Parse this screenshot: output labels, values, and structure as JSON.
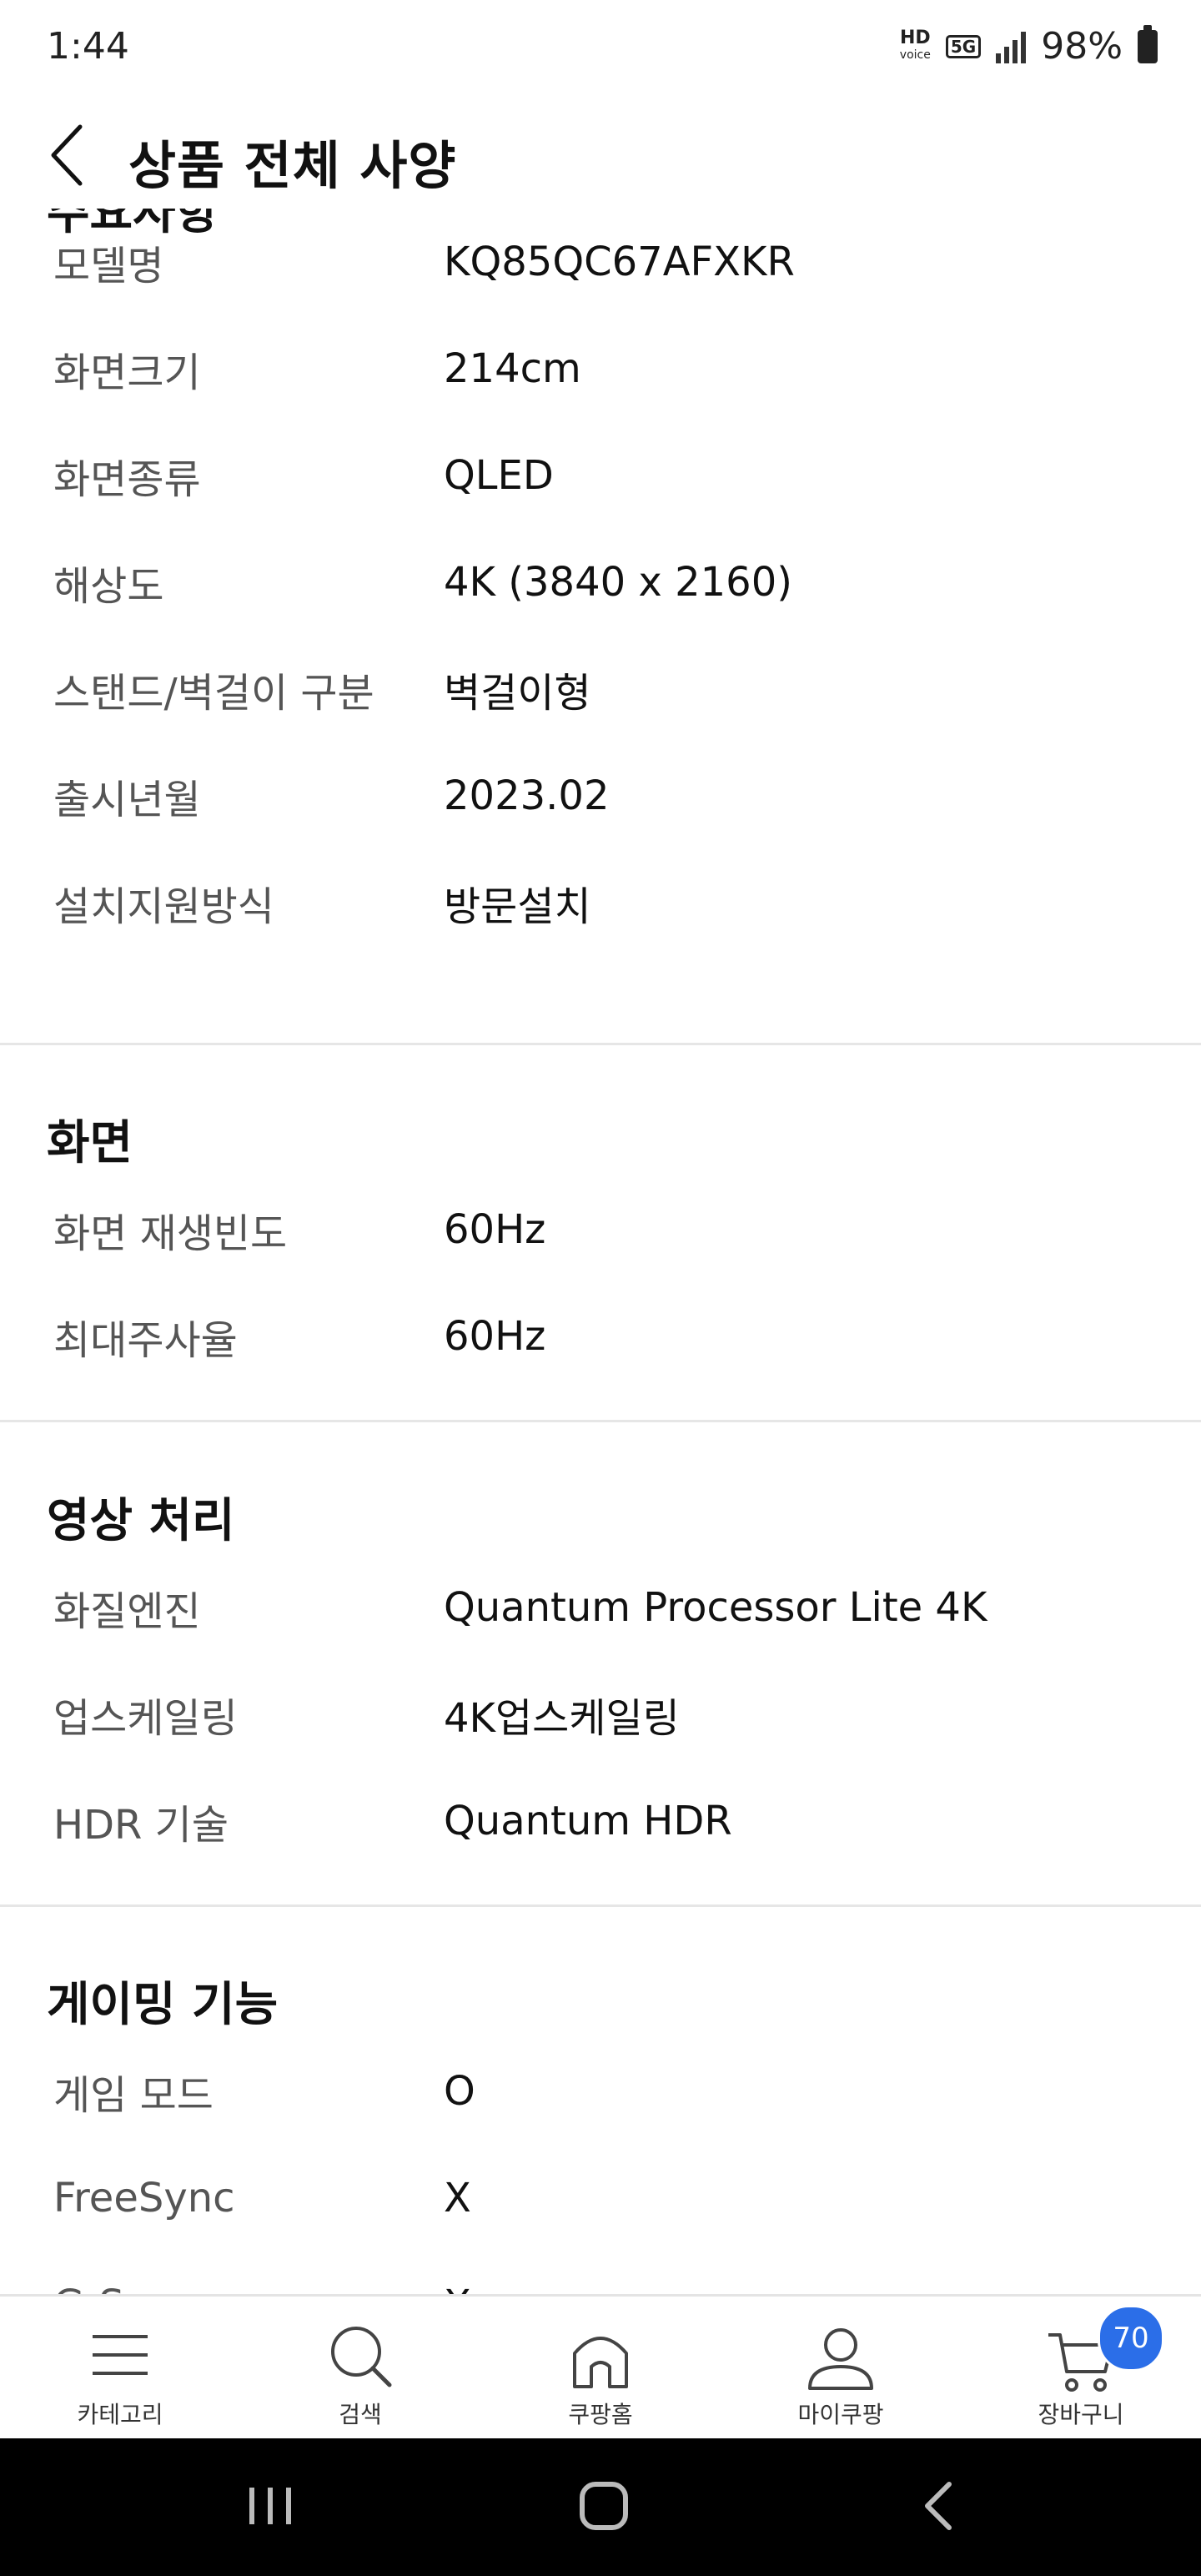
{
  "status_bar": {
    "time": "1:44",
    "hd_label": "HD",
    "voice_label": "voice",
    "network_label": "5G",
    "battery": "98%"
  },
  "header": {
    "title": "상품 전체 사양",
    "back_icon": "chevron-left-icon"
  },
  "partial_section_title": "주요사항",
  "sections": [
    {
      "rows": [
        {
          "label": "모델명",
          "value": "KQ85QC67AFXKR"
        },
        {
          "label": "화면크기",
          "value": "214cm"
        },
        {
          "label": "화면종류",
          "value": "QLED"
        },
        {
          "label": "해상도",
          "value": "4K (3840 x 2160)"
        },
        {
          "label": "스탠드/벽걸이 구분",
          "value": "벽걸이형"
        },
        {
          "label": "출시년월",
          "value": "2023.02"
        },
        {
          "label": "설치지원방식",
          "value": "방문설치"
        }
      ]
    },
    {
      "title": "화면",
      "rows": [
        {
          "label": "화면 재생빈도",
          "value": "60Hz"
        },
        {
          "label": "최대주사율",
          "value": "60Hz"
        }
      ]
    },
    {
      "title": "영상 처리",
      "rows": [
        {
          "label": "화질엔진",
          "value": "Quantum Processor Lite 4K"
        },
        {
          "label": "업스케일링",
          "value": "4K업스케일링"
        },
        {
          "label": "HDR 기술",
          "value": "Quantum HDR"
        }
      ]
    },
    {
      "title": "게이밍 기능",
      "rows": [
        {
          "label": "게임 모드",
          "value": "O"
        },
        {
          "label": "FreeSync",
          "value": "X"
        },
        {
          "label": "G-S",
          "value": "X"
        }
      ]
    }
  ],
  "bottom_nav": {
    "items": [
      {
        "label": "카테고리",
        "icon": "menu-icon"
      },
      {
        "label": "검색",
        "icon": "search-icon"
      },
      {
        "label": "쿠팡홈",
        "icon": "home-icon"
      },
      {
        "label": "마이쿠팡",
        "icon": "person-icon"
      },
      {
        "label": "장바구니",
        "icon": "cart-icon"
      }
    ],
    "cart_badge": "70"
  },
  "colors": {
    "accent": "#2b6ee8",
    "label_gray": "#555555",
    "divider": "#e6e6e6"
  }
}
